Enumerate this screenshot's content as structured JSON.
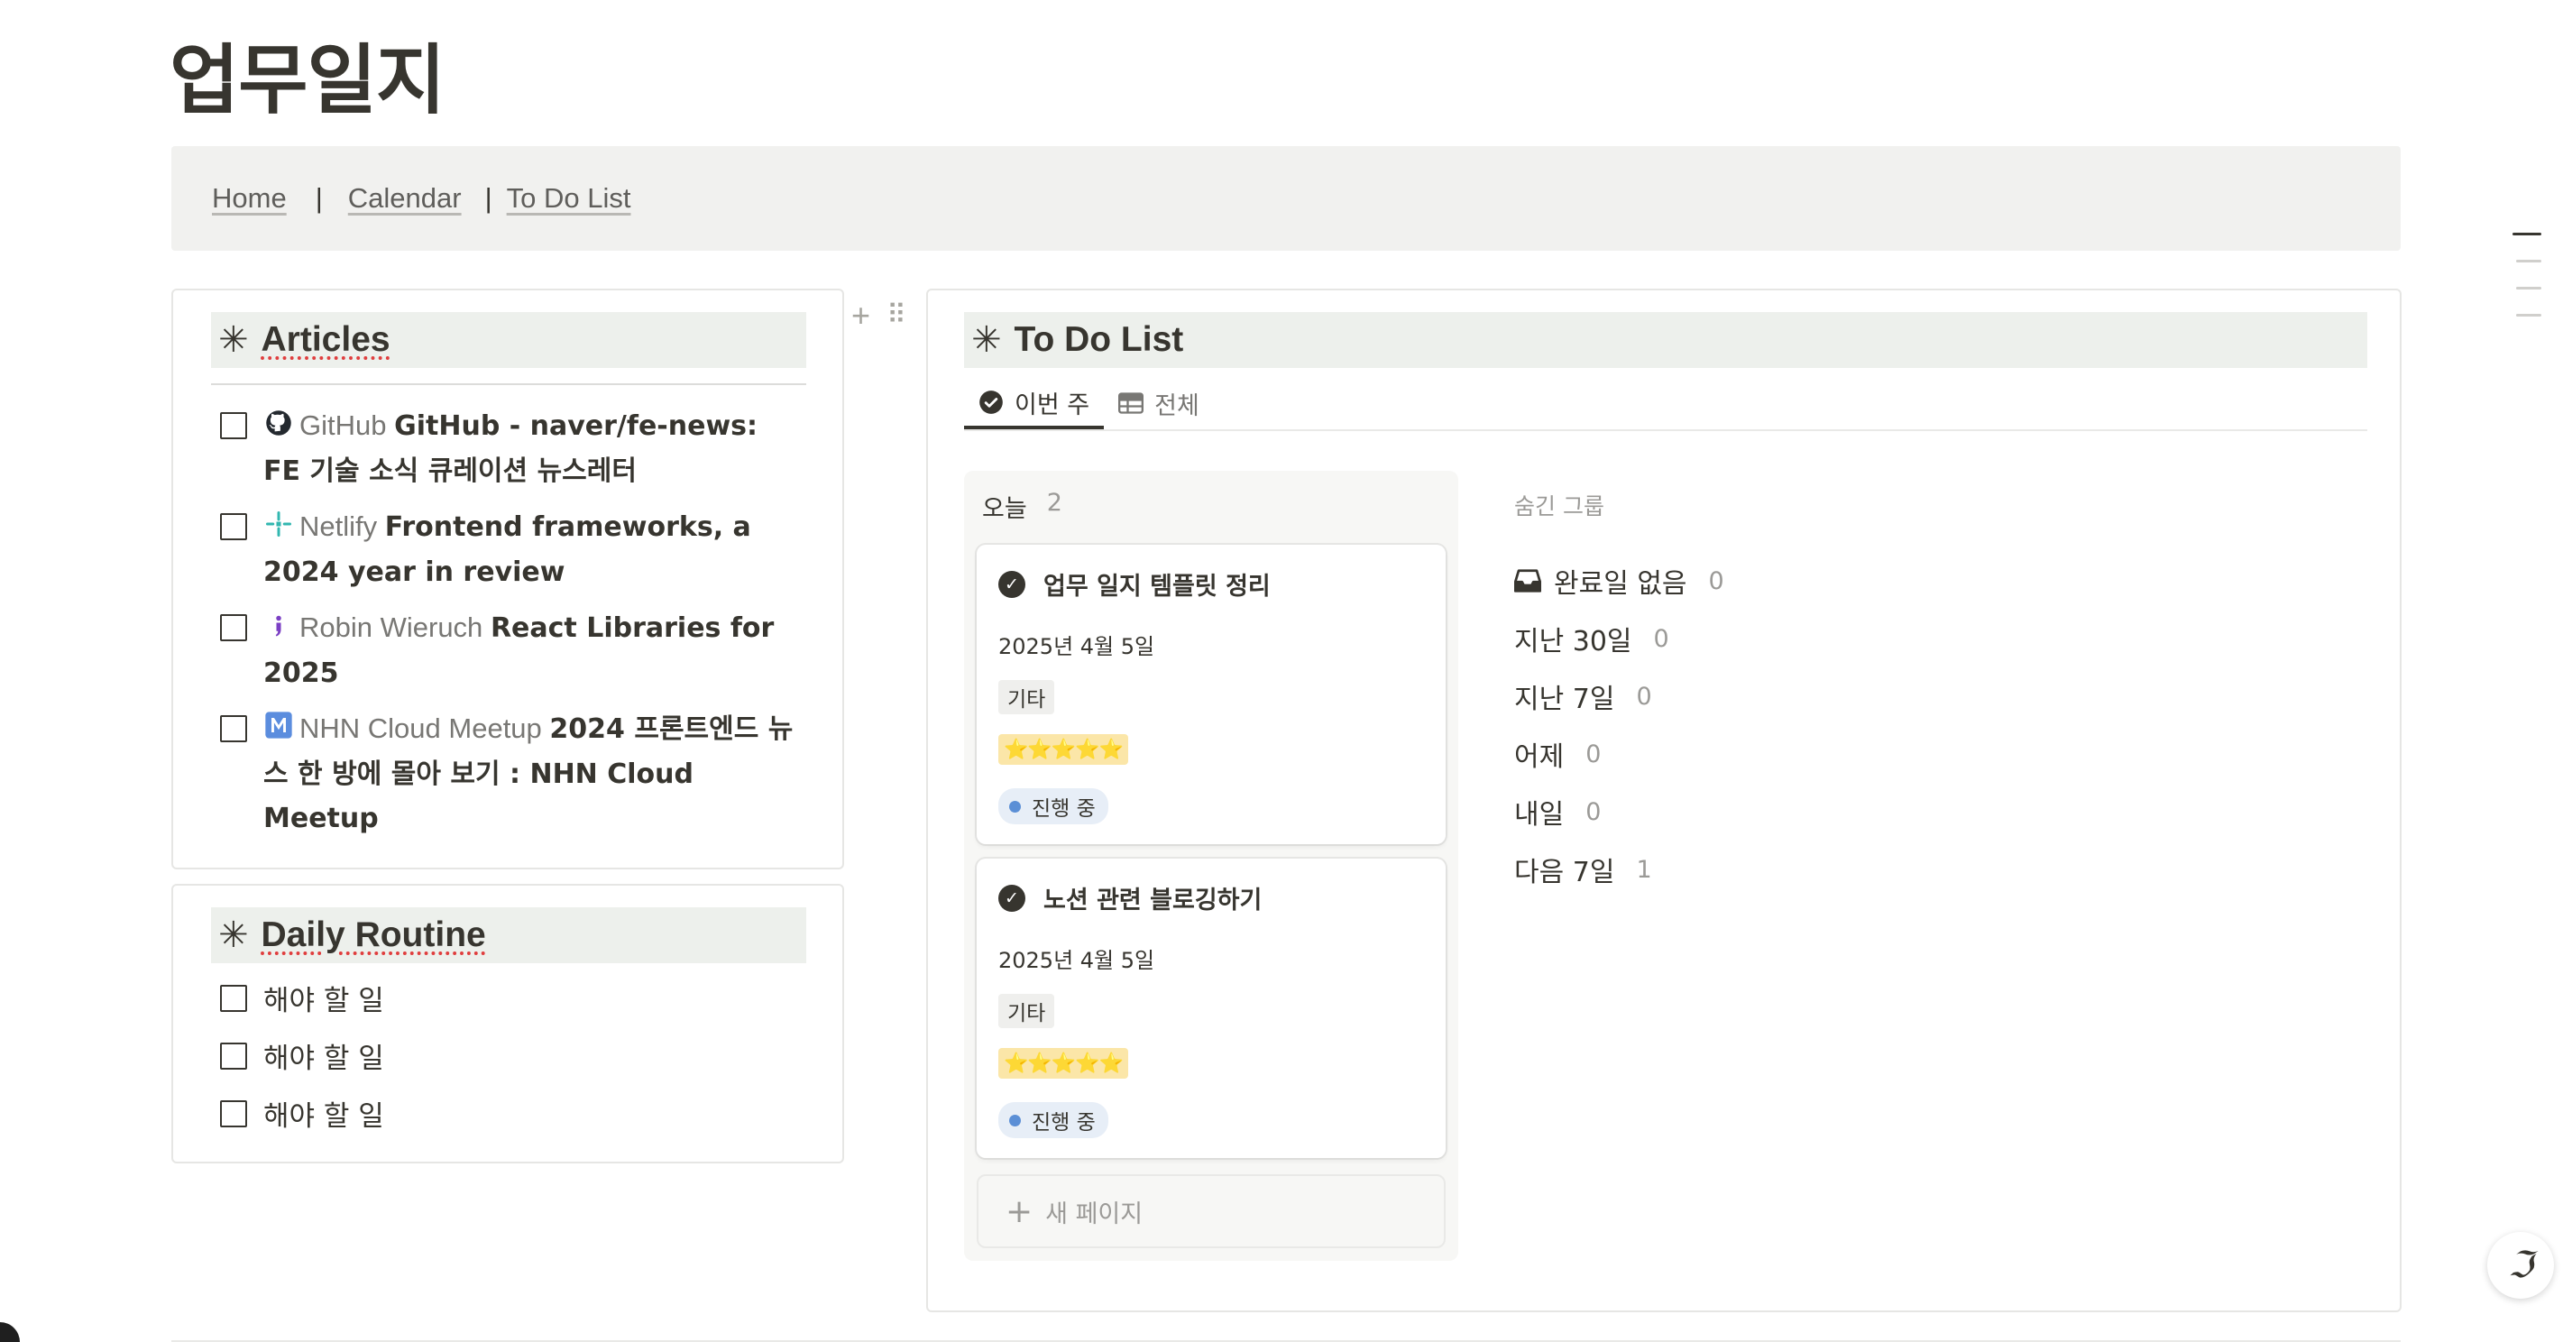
{
  "page": {
    "title": "업무일지"
  },
  "nav": {
    "links": [
      "Home",
      "Calendar",
      "To Do List"
    ],
    "separator": "|"
  },
  "articles": {
    "title": "Articles",
    "items": [
      {
        "source": "GitHub",
        "source_icon": "github-icon",
        "title": "GitHub - naver/fe-news: FE 기술 소식 큐레이션 뉴스레터"
      },
      {
        "source": "Netlify",
        "source_icon": "netlify-icon",
        "title": "Frontend frameworks, a 2024 year in review"
      },
      {
        "source": "Robin Wieruch",
        "source_icon": "robin-wieruch-icon",
        "title": "React Libraries for 2025"
      },
      {
        "source": "NHN Cloud Meetup",
        "source_icon": "nhn-cloud-icon",
        "title": "2024 프론트엔드 뉴스 한 방에 몰아 보기 : NHN Cloud Meetup"
      }
    ]
  },
  "daily_routine": {
    "title": "Daily Routine",
    "items": [
      "해야 할 일",
      "해야 할 일",
      "해야 할 일"
    ]
  },
  "todo": {
    "title": "To Do List",
    "tabs": [
      {
        "label": "이번 주",
        "icon": "check-circle-icon",
        "active": true
      },
      {
        "label": "전체",
        "icon": "table-icon",
        "active": false
      }
    ],
    "column": {
      "label": "오늘",
      "count": "2",
      "cards": [
        {
          "title": "업무 일지 템플릿 정리",
          "date": "2025년 4월 5일",
          "tag": "기타",
          "rating": "⭐⭐⭐⭐⭐",
          "status": "진행 중"
        },
        {
          "title": "노션 관련 블로깅하기",
          "date": "2025년 4월 5일",
          "tag": "기타",
          "rating": "⭐⭐⭐⭐⭐",
          "status": "진행 중"
        }
      ],
      "new_page": "새 페이지"
    },
    "hidden_groups": {
      "label": "숨긴 그룹",
      "items": [
        {
          "label": "완료일 없음",
          "count": "0",
          "icon": "inbox-icon"
        },
        {
          "label": "지난 30일",
          "count": "0"
        },
        {
          "label": "지난 7일",
          "count": "0"
        },
        {
          "label": "어제",
          "count": "0"
        },
        {
          "label": "내일",
          "count": "0"
        },
        {
          "label": "다음 7일",
          "count": "1"
        }
      ]
    }
  },
  "colors": {
    "header_bg": "#edf0ec",
    "callout_bg": "#f1f1ef",
    "status_dot": "#5b8fd6",
    "rating_bg": "#fbe6a8"
  }
}
